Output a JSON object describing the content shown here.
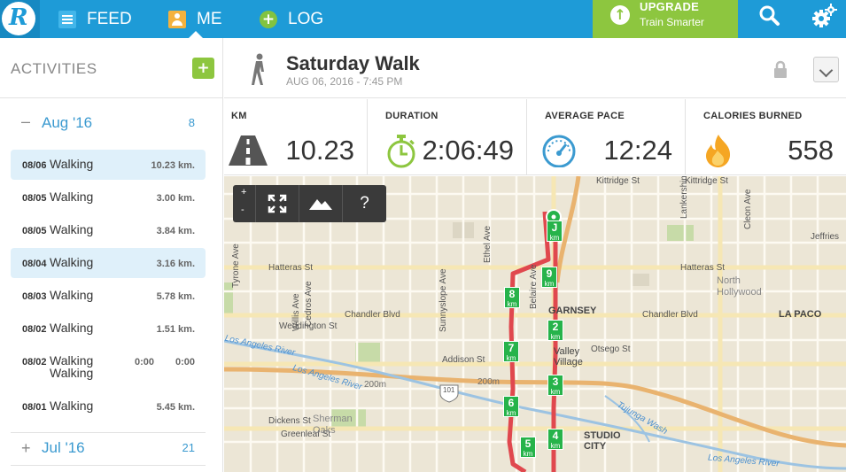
{
  "nav": {
    "feed": "FEED",
    "me": "ME",
    "log": "LOG",
    "upgrade_title": "UPGRADE",
    "upgrade_sub": "Train Smarter"
  },
  "sidebar": {
    "title": "ACTIVITIES",
    "months": [
      {
        "sign": "–",
        "name": "Aug '16",
        "count": "8"
      },
      {
        "sign": "+",
        "name": "Jul '16",
        "count": "21"
      }
    ],
    "activities": [
      {
        "date": "08/06",
        "name": "Walking",
        "distance": "10.23 km.",
        "selected": true
      },
      {
        "date": "08/05",
        "name": "Walking",
        "distance": "3.00 km."
      },
      {
        "date": "08/05",
        "name": "Walking",
        "distance": "3.84 km."
      },
      {
        "date": "08/04",
        "name": "Walking",
        "distance": "3.16 km.",
        "selected": true
      },
      {
        "date": "08/03",
        "name": "Walking",
        "distance": "5.78 km."
      },
      {
        "date": "08/02",
        "name": "Walking",
        "distance": "1.51 km."
      },
      {
        "date": "08/02",
        "name": "Walking\nWalking",
        "duration": "0:00",
        "distance": "0:00"
      },
      {
        "date": "08/01",
        "name": "Walking",
        "distance": "5.45 km."
      }
    ]
  },
  "activity": {
    "title": "Saturday Walk",
    "date": "AUG 06, 2016  -  7:45 PM"
  },
  "stats": {
    "km_label": "KM",
    "km_value": "10.23",
    "duration_label": "DURATION",
    "duration_value": "2:06:49",
    "pace_label": "AVERAGE PACE",
    "pace_value": "12:24",
    "calories_label": "CALORIES BURNED",
    "calories_value": "558"
  },
  "map": {
    "zoom_in": "+",
    "zoom_out": "-",
    "help": "?",
    "streets": {
      "kittridge": "Kittridge St",
      "kittridge2": "Kittridge St",
      "hatteras": "Hatteras St",
      "hatteras2": "Hatteras St",
      "chandler": "Chandler Blvd",
      "chandler2": "Chandler Blvd",
      "weddington": "Weddington St",
      "addison": "Addison St",
      "otsego": "Otsego St",
      "dickens": "Dickens St",
      "greenleaf": "Greenleaf St",
      "ethel": "Ethel Ave",
      "belaire": "Belaire Ave",
      "sunnyslope": "Sunnyslope Ave",
      "cedros": "Cedros Ave",
      "willis": "Willis Ave",
      "tyrone": "Tyrone Ave",
      "cleon": "Cleon Ave",
      "jeffries": "Jeffries",
      "lankershim": "Lankershim",
      "hwy": "101",
      "tujunga": "Tujunga Wash"
    },
    "areas": {
      "garnsey": "GARNSEY",
      "valley_village": "Valley\nVillage",
      "north_hollywood": "North\nHollywood",
      "la_paco": "LA PACO",
      "studio_city": "STUDIO\nCITY",
      "sherman_oaks": "Sherman\nOaks"
    },
    "rivers": {
      "la_river_1": "Los Angeles River",
      "la_river_2": "Los Angeles River",
      "la_river_3": "Los Angeles River",
      "contour_200_1": "200m",
      "contour_200_2": "200m"
    },
    "km_unit": "km",
    "km_markers": [
      "J",
      "9",
      "8",
      "2",
      "7",
      "3",
      "6",
      "4",
      "5"
    ]
  },
  "colors": {
    "brand_blue": "#1e9bd7",
    "accent_green": "#8dc63f",
    "route_red": "#e0484e",
    "marker_green": "#26b34a"
  }
}
